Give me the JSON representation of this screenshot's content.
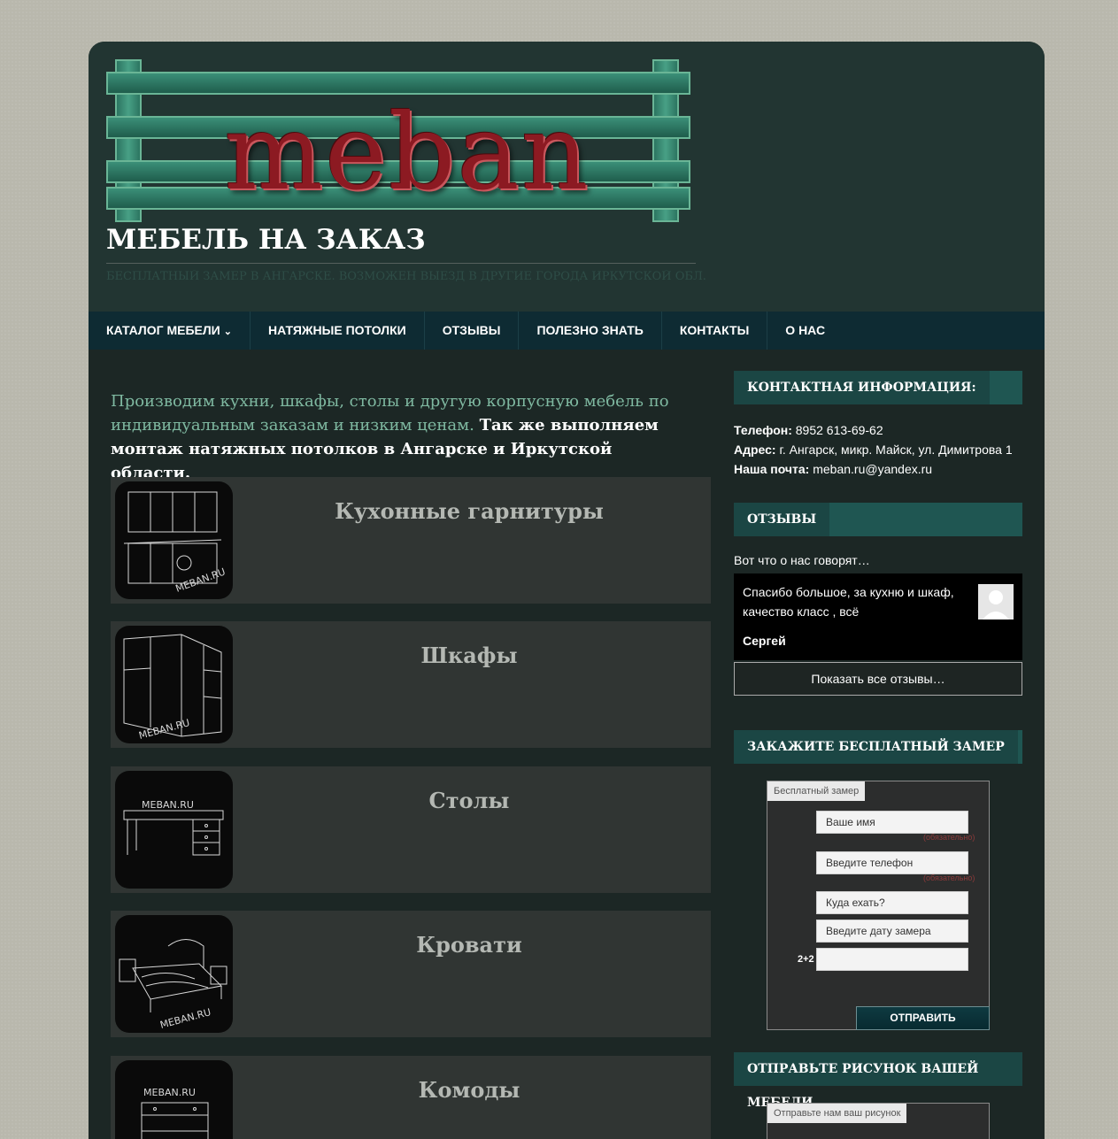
{
  "header": {
    "logo_text": "meban",
    "site_title": "МЕБЕЛЬ НА ЗАКАЗ",
    "tagline": "БЕСПЛАТНЫЙ ЗАМЕР В АНГАРСКЕ. ВОЗМОЖЕН ВЫЕЗД В ДРУГИЕ ГОРОДА ИРКУТСКОЙ ОБЛ."
  },
  "nav": {
    "items": [
      {
        "label": "КАТАЛОГ МЕБЕЛИ"
      },
      {
        "label": "НАТЯЖНЫЕ ПОТОЛКИ"
      },
      {
        "label": "ОТЗЫВЫ"
      },
      {
        "label": "ПОЛЕЗНО ЗНАТЬ"
      },
      {
        "label": "КОНТАКТЫ"
      },
      {
        "label": "О НАС"
      }
    ]
  },
  "main": {
    "intro_part1": "Производим кухни, шкафы, столы и другую корпусную мебель по индивидуальным заказам и низким ценам.",
    "intro_part2": "Так же выполняем монтаж натяжных потолков в Ангарске и Иркутской области.",
    "categories": [
      {
        "title": "Кухонные гарнитуры",
        "watermark": "MEBAN.RU"
      },
      {
        "title": "Шкафы",
        "watermark": "MEBAN.RU"
      },
      {
        "title": "Столы",
        "watermark": "MEBAN.RU"
      },
      {
        "title": "Кровати",
        "watermark": "MEBAN.RU"
      },
      {
        "title": "Комоды",
        "watermark": "MEBAN.RU"
      }
    ]
  },
  "sidebar": {
    "contact": {
      "heading": "КОНТАКТНАЯ ИНФОРМАЦИЯ:",
      "phone_label": "Телефон:",
      "phone": "8952 613-69-62",
      "address_label": "Адрес:",
      "address": "г. Ангарск, микр. Майск, ул. Димитрова 1",
      "email_label": "Наша почта:",
      "email": "meban.ru@yandex.ru"
    },
    "reviews": {
      "heading": "ОТЗЫВЫ",
      "intro": "Вот что о нас говорят…",
      "text": "Спасибо большое, за кухню и шкаф, качество класс , всё",
      "author": "Сергей",
      "show_all": "Показать все отзывы…"
    },
    "order": {
      "heading": "ЗАКАЖИТЕ БЕСПЛАТНЫЙ ЗАМЕР",
      "form_tab": "Бесплатный замер",
      "name_placeholder": "Ваше имя",
      "phone_placeholder": "Введите телефон",
      "where_placeholder": "Куда ехать?",
      "date_placeholder": "Введите дату замера",
      "required_note": "(обязательно)",
      "captcha_label": "2+2",
      "submit": "ОТПРАВИТЬ"
    },
    "drawing": {
      "heading": "ОТПРАВЬТЕ РИСУНОК ВАШЕЙ МЕБЕЛИ",
      "form_tab": "Отправьте нам ваш рисунок"
    }
  }
}
